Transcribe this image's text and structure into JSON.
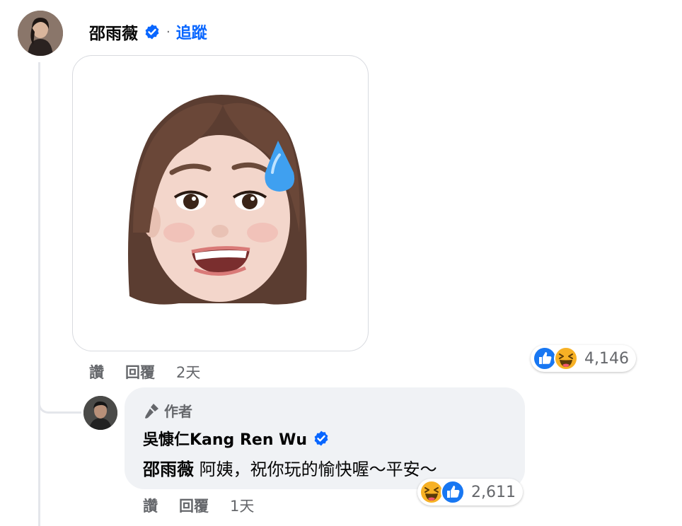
{
  "comment": {
    "author": "邵雨薇",
    "separator": "·",
    "follow_label": "追蹤",
    "sticker_icon": "memoji-sweat-smile",
    "actions": {
      "like": "讚",
      "reply": "回覆",
      "time": "2天"
    },
    "reactions": {
      "icons": [
        "like-reaction",
        "haha-reaction"
      ],
      "count": "4,146"
    }
  },
  "reply": {
    "badge_label": "作者",
    "author": "吳慷仁Kang Ren Wu",
    "mention": "邵雨薇",
    "text": " 阿姨，祝你玩的愉快喔～平安～",
    "actions": {
      "like": "讚",
      "reply": "回覆",
      "time": "1天"
    },
    "reactions": {
      "icons": [
        "haha-reaction",
        "like-reaction"
      ],
      "count": "2,611"
    }
  },
  "colors": {
    "link_blue": "#0866ff",
    "bubble_bg": "#f0f2f5",
    "meta_gray": "#65676b"
  }
}
